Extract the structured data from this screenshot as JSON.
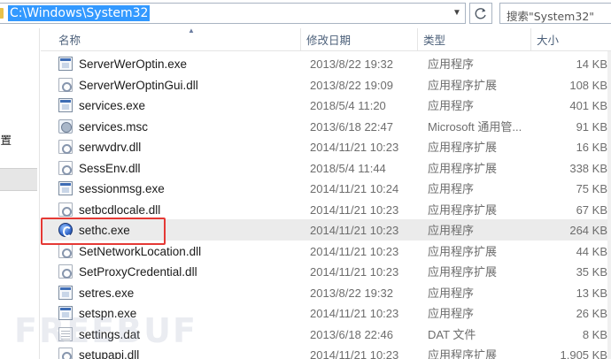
{
  "address_bar": {
    "path": "C:\\Windows\\System32",
    "search_placeholder": "搜索\"System32\""
  },
  "nav": {
    "partial_label": "设置"
  },
  "columns": {
    "name": "名称",
    "date": "修改日期",
    "type": "类型",
    "size": "大小"
  },
  "rows": [
    {
      "name": "ServerWerOptin.exe",
      "date": "2013/8/22 19:32",
      "type": "应用程序",
      "size": "14 KB",
      "icon": "exe-icon"
    },
    {
      "name": "ServerWerOptinGui.dll",
      "date": "2013/8/22 19:09",
      "type": "应用程序扩展",
      "size": "108 KB",
      "icon": "dll-icon"
    },
    {
      "name": "services.exe",
      "date": "2018/5/4 11:20",
      "type": "应用程序",
      "size": "401 KB",
      "icon": "exe-icon"
    },
    {
      "name": "services.msc",
      "date": "2013/6/18 22:47",
      "type": "Microsoft 通用管...",
      "size": "91 KB",
      "icon": "msc-icon"
    },
    {
      "name": "serwvdrv.dll",
      "date": "2014/11/21 10:23",
      "type": "应用程序扩展",
      "size": "16 KB",
      "icon": "dll-icon"
    },
    {
      "name": "SessEnv.dll",
      "date": "2018/5/4 11:44",
      "type": "应用程序扩展",
      "size": "338 KB",
      "icon": "dll-icon"
    },
    {
      "name": "sessionmsg.exe",
      "date": "2014/11/21 10:24",
      "type": "应用程序",
      "size": "75 KB",
      "icon": "exe-icon"
    },
    {
      "name": "setbcdlocale.dll",
      "date": "2014/11/21 10:23",
      "type": "应用程序扩展",
      "size": "67 KB",
      "icon": "dll-icon"
    },
    {
      "name": "sethc.exe",
      "date": "2014/11/21 10:23",
      "type": "应用程序",
      "size": "264 KB",
      "icon": "sethc-icon"
    },
    {
      "name": "SetNetworkLocation.dll",
      "date": "2014/11/21 10:23",
      "type": "应用程序扩展",
      "size": "44 KB",
      "icon": "dll-icon"
    },
    {
      "name": "SetProxyCredential.dll",
      "date": "2014/11/21 10:23",
      "type": "应用程序扩展",
      "size": "35 KB",
      "icon": "dll-icon"
    },
    {
      "name": "setres.exe",
      "date": "2013/8/22 19:32",
      "type": "应用程序",
      "size": "13 KB",
      "icon": "exe-icon"
    },
    {
      "name": "setspn.exe",
      "date": "2014/11/21 10:23",
      "type": "应用程序",
      "size": "26 KB",
      "icon": "exe-icon"
    },
    {
      "name": "settings.dat",
      "date": "2013/6/18 22:46",
      "type": "DAT 文件",
      "size": "8 KB",
      "icon": "dat-icon"
    },
    {
      "name": "setupapi.dll",
      "date": "2014/11/21 10:23",
      "type": "应用程序扩展",
      "size": "1,905 KB",
      "icon": "dll-icon"
    }
  ],
  "selected_row": "sethc.exe",
  "highlight_color": "#e53935",
  "watermark": "FREEBUF"
}
